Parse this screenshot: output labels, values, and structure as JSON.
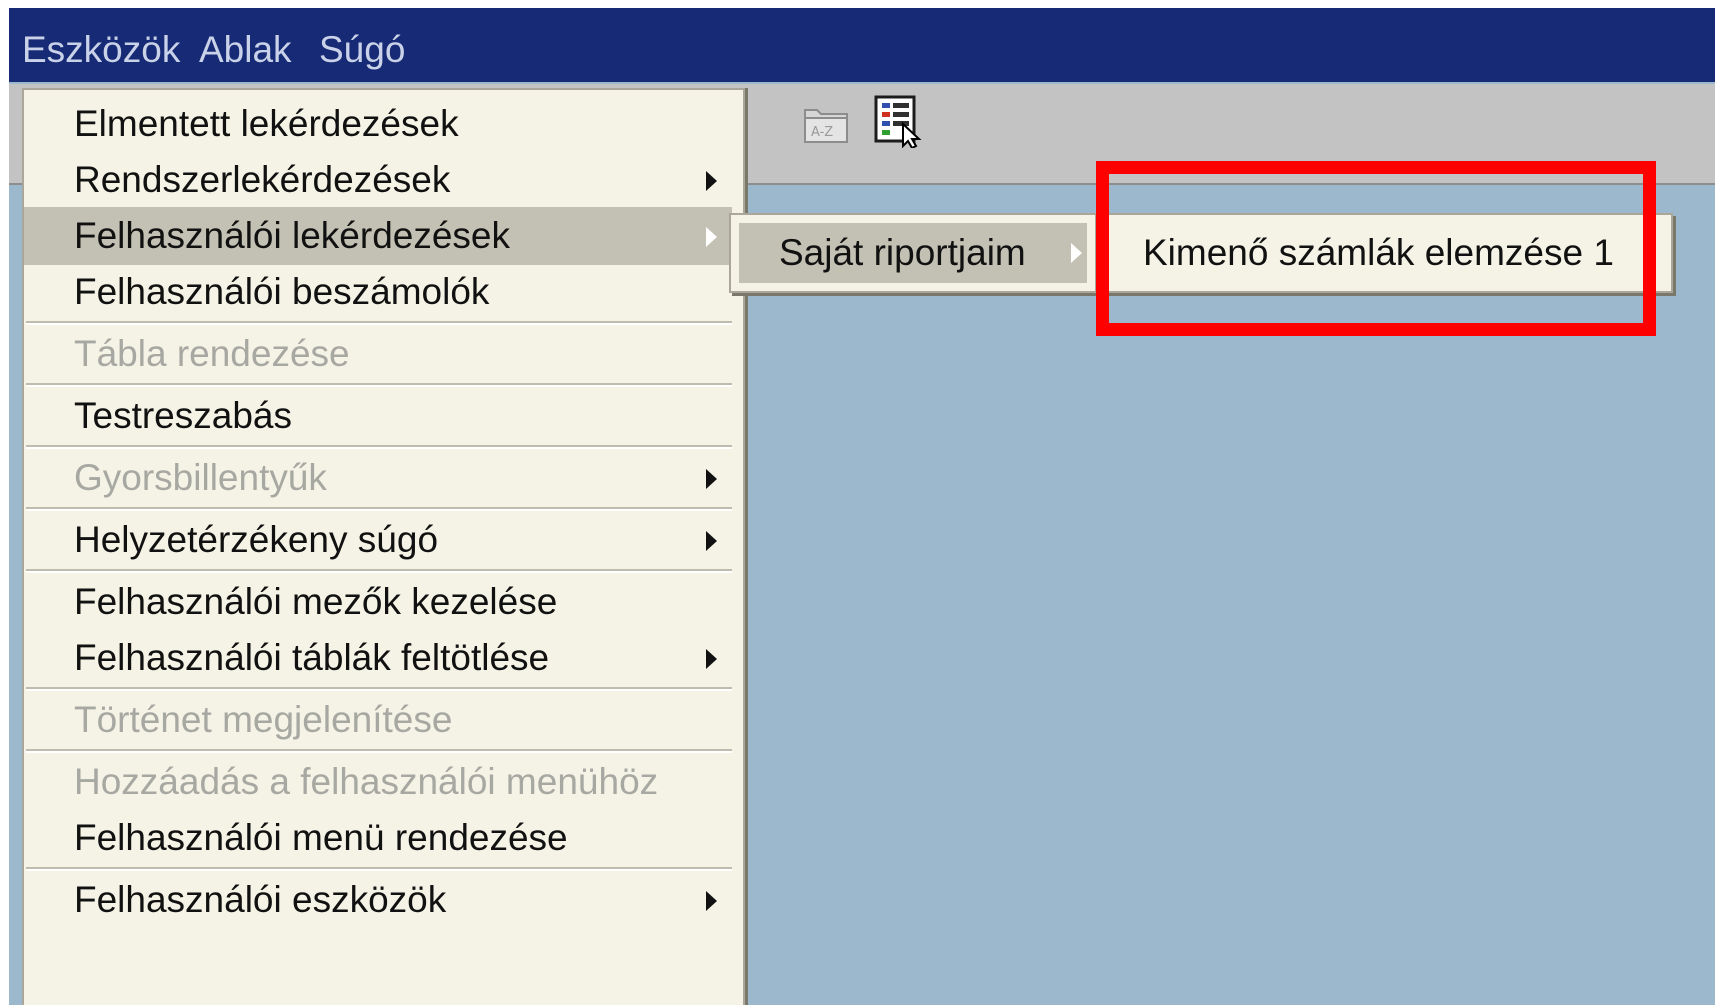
{
  "menubar": {
    "items": [
      {
        "label": "Eszközök"
      },
      {
        "label": "Ablak"
      },
      {
        "label": "Súgó"
      }
    ]
  },
  "toolbar": {
    "icons": [
      "sort-az-icon",
      "report-icon"
    ]
  },
  "tools_menu": {
    "items": [
      {
        "label": "Elmentett lekérdezések",
        "submenu": false,
        "enabled": true
      },
      {
        "label": "Rendszerlekérdezések",
        "submenu": true,
        "enabled": true
      },
      {
        "label": "Felhasználói lekérdezések",
        "submenu": true,
        "enabled": true,
        "selected": true
      },
      {
        "label": "Felhasználói beszámolók",
        "submenu": false,
        "enabled": true
      },
      {
        "label": "Tábla rendezése",
        "submenu": false,
        "enabled": false
      },
      {
        "label": "Testreszabás",
        "submenu": false,
        "enabled": true
      },
      {
        "label": "Gyorsbillentyűk",
        "submenu": true,
        "enabled": false
      },
      {
        "label": "Helyzetérzékeny súgó",
        "submenu": true,
        "enabled": true
      },
      {
        "label": "Felhasználói mezők kezelése",
        "submenu": false,
        "enabled": true
      },
      {
        "label": "Felhasználói táblák feltötlése",
        "submenu": true,
        "enabled": true
      },
      {
        "label": "Történet megjelenítése",
        "submenu": false,
        "enabled": false
      },
      {
        "label": "Hozzáadás a felhasználói menühöz",
        "submenu": false,
        "enabled": false
      },
      {
        "label": "Felhasználói menü rendezése",
        "submenu": false,
        "enabled": true
      },
      {
        "label": "Felhasználói eszközök",
        "submenu": true,
        "enabled": true
      }
    ]
  },
  "submenu_user_queries": {
    "items": [
      {
        "label": "Saját riportjaim",
        "submenu": true,
        "selected": true
      }
    ]
  },
  "submenu_my_reports": {
    "items": [
      {
        "label": "Kimenő számlák elemzése 1"
      }
    ]
  },
  "colors": {
    "menubar_bg": "#162a75",
    "menu_bg": "#f4f3e6",
    "selected_bg": "#c3c1b3",
    "workspace_bg": "#9cb8cc",
    "highlight": "#ff0000"
  }
}
